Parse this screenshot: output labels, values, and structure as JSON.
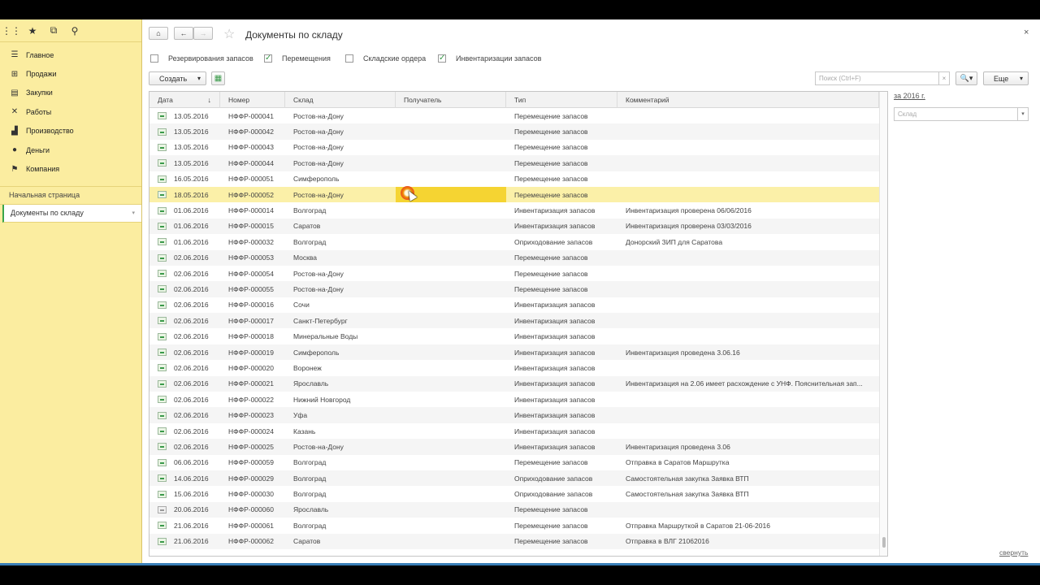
{
  "left_panel": {
    "top_icons": [
      "apps-grid-icon",
      "favorites-star-icon",
      "history-icon",
      "search-icon"
    ],
    "sections": [
      {
        "label": "Главное",
        "icon": "menu-lines-icon"
      },
      {
        "label": "Продажи",
        "icon": "basket-icon"
      },
      {
        "label": "Закупки",
        "icon": "cart-icon"
      },
      {
        "label": "Работы",
        "icon": "tools-icon"
      },
      {
        "label": "Производство",
        "icon": "factory-icon"
      },
      {
        "label": "Деньги",
        "icon": "money-icon"
      },
      {
        "label": "Компания",
        "icon": "flag-icon"
      }
    ],
    "opened": [
      {
        "label": "Начальная страница"
      },
      {
        "label": "Документы по складу"
      }
    ]
  },
  "header": {
    "title": "Документы по складу",
    "close_label": "×"
  },
  "filters": [
    {
      "label": "Резервирования запасов",
      "checked": false
    },
    {
      "label": "Перемещения",
      "checked": true
    },
    {
      "label": "Складские ордера",
      "checked": false
    },
    {
      "label": "Инвентаризации запасов",
      "checked": true
    }
  ],
  "toolbar": {
    "create_label": "Создать",
    "create_arrow": "▾",
    "search_placeholder": "Поиск (Ctrl+F)",
    "search_clear": "×",
    "search_btn": "🔍▾",
    "more_label": "Еще",
    "more_arrow": "▾"
  },
  "table": {
    "columns": [
      "Дата",
      "Номер",
      "Склад",
      "Получатель",
      "Тип",
      "Комментарий"
    ],
    "sort_arrow": "↓",
    "selected_index": 5,
    "rows": [
      {
        "date": "13.05.2016",
        "number": "НФФР-000041",
        "warehouse": "Ростов-на-Дону",
        "recipient": "",
        "type": "Перемещение запасов",
        "comment": ""
      },
      {
        "date": "13.05.2016",
        "number": "НФФР-000042",
        "warehouse": "Ростов-на-Дону",
        "recipient": "",
        "type": "Перемещение запасов",
        "comment": ""
      },
      {
        "date": "13.05.2016",
        "number": "НФФР-000043",
        "warehouse": "Ростов-на-Дону",
        "recipient": "",
        "type": "Перемещение запасов",
        "comment": ""
      },
      {
        "date": "13.05.2016",
        "number": "НФФР-000044",
        "warehouse": "Ростов-на-Дону",
        "recipient": "",
        "type": "Перемещение запасов",
        "comment": ""
      },
      {
        "date": "16.05.2016",
        "number": "НФФР-000051",
        "warehouse": "Симферополь",
        "recipient": "",
        "type": "Перемещение запасов",
        "comment": ""
      },
      {
        "date": "18.05.2016",
        "number": "НФФР-000052",
        "warehouse": "Ростов-на-Дону",
        "recipient": "",
        "type": "Перемещение запасов",
        "comment": ""
      },
      {
        "date": "01.06.2016",
        "number": "НФФР-000014",
        "warehouse": "Волгоград",
        "recipient": "",
        "type": "Инвентаризация запасов",
        "comment": "Инвентаризация проверена 06/06/2016"
      },
      {
        "date": "01.06.2016",
        "number": "НФФР-000015",
        "warehouse": "Саратов",
        "recipient": "",
        "type": "Инвентаризация запасов",
        "comment": "Инвентаризация проверена 03/03/2016"
      },
      {
        "date": "01.06.2016",
        "number": "НФФР-000032",
        "warehouse": "Волгоград",
        "recipient": "",
        "type": "Оприходование запасов",
        "comment": "Донорский ЗИП для Саратова"
      },
      {
        "date": "02.06.2016",
        "number": "НФФР-000053",
        "warehouse": "Москва",
        "recipient": "",
        "type": "Перемещение запасов",
        "comment": ""
      },
      {
        "date": "02.06.2016",
        "number": "НФФР-000054",
        "warehouse": "Ростов-на-Дону",
        "recipient": "",
        "type": "Перемещение запасов",
        "comment": ""
      },
      {
        "date": "02.06.2016",
        "number": "НФФР-000055",
        "warehouse": "Ростов-на-Дону",
        "recipient": "",
        "type": "Перемещение запасов",
        "comment": ""
      },
      {
        "date": "02.06.2016",
        "number": "НФФР-000016",
        "warehouse": "Сочи",
        "recipient": "",
        "type": "Инвентаризация запасов",
        "comment": ""
      },
      {
        "date": "02.06.2016",
        "number": "НФФР-000017",
        "warehouse": "Санкт-Петербург",
        "recipient": "",
        "type": "Инвентаризация запасов",
        "comment": ""
      },
      {
        "date": "02.06.2016",
        "number": "НФФР-000018",
        "warehouse": "Минеральные Воды",
        "recipient": "",
        "type": "Инвентаризация запасов",
        "comment": ""
      },
      {
        "date": "02.06.2016",
        "number": "НФФР-000019",
        "warehouse": "Симферополь",
        "recipient": "",
        "type": "Инвентаризация запасов",
        "comment": "Инвентаризация проведена 3.06.16"
      },
      {
        "date": "02.06.2016",
        "number": "НФФР-000020",
        "warehouse": "Воронеж",
        "recipient": "",
        "type": "Инвентаризация запасов",
        "comment": ""
      },
      {
        "date": "02.06.2016",
        "number": "НФФР-000021",
        "warehouse": "Ярославль",
        "recipient": "",
        "type": "Инвентаризация запасов",
        "comment": "Инвентаризация на 2.06 имеет расхождение с УНФ. Пояснительная зап..."
      },
      {
        "date": "02.06.2016",
        "number": "НФФР-000022",
        "warehouse": "Нижний Новгород",
        "recipient": "",
        "type": "Инвентаризация запасов",
        "comment": ""
      },
      {
        "date": "02.06.2016",
        "number": "НФФР-000023",
        "warehouse": "Уфа",
        "recipient": "",
        "type": "Инвентаризация запасов",
        "comment": ""
      },
      {
        "date": "02.06.2016",
        "number": "НФФР-000024",
        "warehouse": "Казань",
        "recipient": "",
        "type": "Инвентаризация запасов",
        "comment": ""
      },
      {
        "date": "02.06.2016",
        "number": "НФФР-000025",
        "warehouse": "Ростов-на-Дону",
        "recipient": "",
        "type": "Инвентаризация запасов",
        "comment": "Инвентаризация проведена 3.06"
      },
      {
        "date": "06.06.2016",
        "number": "НФФР-000059",
        "warehouse": "Волгоград",
        "recipient": "",
        "type": "Перемещение запасов",
        "comment": "Отправка в Саратов Маршрутка"
      },
      {
        "date": "14.06.2016",
        "number": "НФФР-000029",
        "warehouse": "Волгоград",
        "recipient": "",
        "type": "Оприходование запасов",
        "comment": "Самостоятельная закупка Заявка ВТП"
      },
      {
        "date": "15.06.2016",
        "number": "НФФР-000030",
        "warehouse": "Волгоград",
        "recipient": "",
        "type": "Оприходование запасов",
        "comment": "Самостоятельная закупка Заявка ВТП"
      },
      {
        "date": "20.06.2016",
        "number": "НФФР-000060",
        "warehouse": "Ярославль",
        "recipient": "",
        "type": "Перемещение запасов",
        "comment": "",
        "posted": false
      },
      {
        "date": "21.06.2016",
        "number": "НФФР-000061",
        "warehouse": "Волгоград",
        "recipient": "",
        "type": "Перемещение запасов",
        "comment": "Отправка Маршруткой в Саратов 21-06-2016"
      },
      {
        "date": "21.06.2016",
        "number": "НФФР-000062",
        "warehouse": "Саратов",
        "recipient": "",
        "type": "Перемещение запасов",
        "comment": "Отправка в ВЛГ 21062016"
      }
    ]
  },
  "right_panel": {
    "period_link": "за 2016 г.",
    "warehouse_placeholder": "Склад",
    "warehouse_arrow": "▾",
    "collapse_link": "свернуть"
  },
  "colors": {
    "panel_bg": "#fbeda0",
    "selected_row": "#fbf0a8",
    "highlight_cell": "#f5d432",
    "check_green": "#3a9a4a"
  }
}
